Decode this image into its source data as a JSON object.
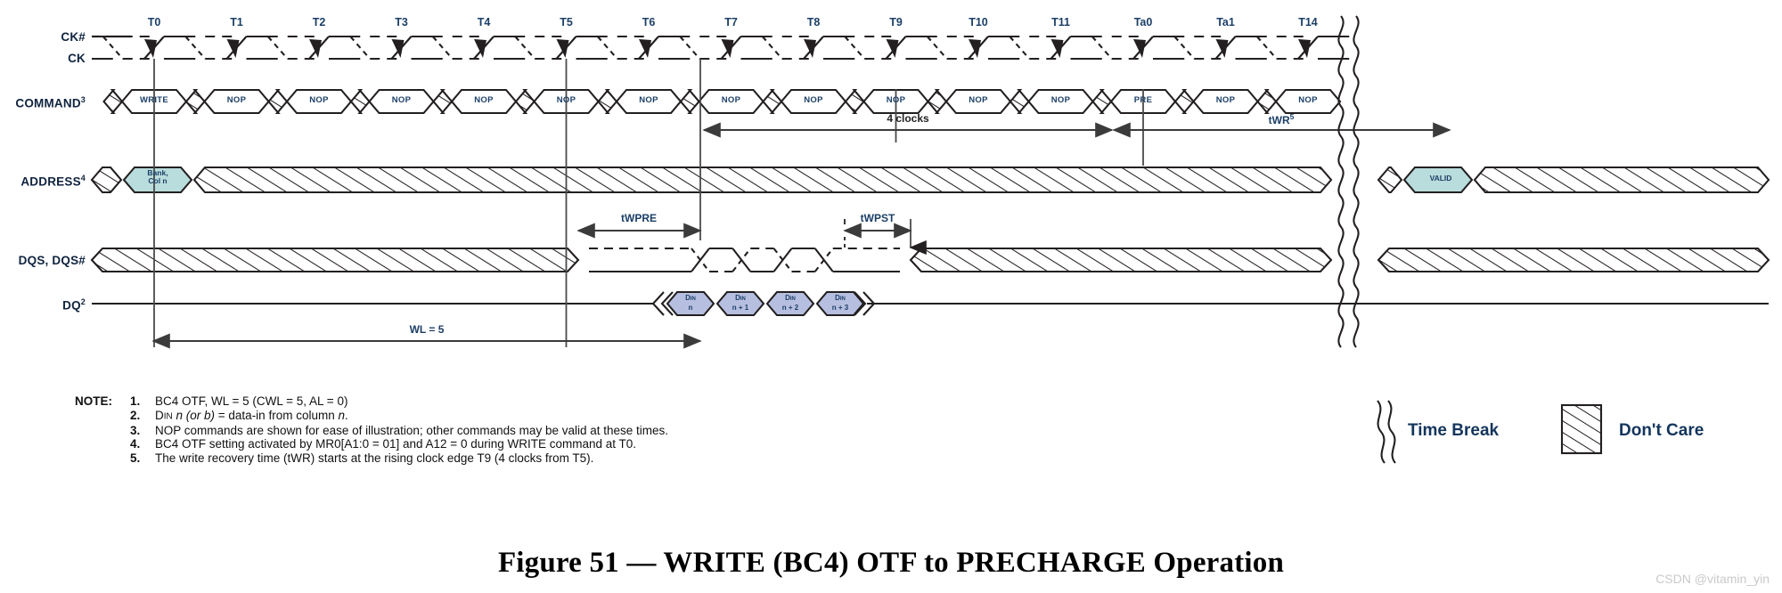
{
  "figure": {
    "title": "Figure 51 — WRITE (BC4) OTF to PRECHARGE Operation",
    "watermark": "CSDN @vitamin_yin"
  },
  "signals": [
    {
      "name": "ck-hash-label",
      "label": "CK#"
    },
    {
      "name": "ck-label",
      "label": "CK"
    },
    {
      "name": "command-label",
      "label": "COMMAND",
      "sup": "3"
    },
    {
      "name": "address-label",
      "label": "ADDRESS",
      "sup": "4"
    },
    {
      "name": "dqs-label",
      "label": "DQS, DQS#"
    },
    {
      "name": "dq-label",
      "label": "DQ",
      "sup": "2"
    }
  ],
  "clock_ticks": [
    "T0",
    "T1",
    "T2",
    "T3",
    "T4",
    "T5",
    "T6",
    "T7",
    "T8",
    "T9",
    "T10",
    "T11",
    "Ta0",
    "Ta1",
    "T14"
  ],
  "command_row": {
    "cells": [
      "WRITE",
      "NOP",
      "NOP",
      "NOP",
      "NOP",
      "NOP",
      "NOP",
      "NOP",
      "NOP",
      "NOP",
      "NOP",
      "NOP",
      "PRE",
      "NOP",
      "NOP"
    ]
  },
  "address_row": {
    "first_label_line1": "Bank,",
    "first_label_line2": "Col n",
    "second_label": "VALID",
    "fill_color": "#b9dcdc"
  },
  "dq_row": {
    "fill_color": "#b7bfe0",
    "beats": [
      {
        "top": "D",
        "sub": "IN",
        "bottom": "n"
      },
      {
        "top": "D",
        "sub": "IN",
        "bottom": "n + 1"
      },
      {
        "top": "D",
        "sub": "IN",
        "bottom": "n + 2"
      },
      {
        "top": "D",
        "sub": "IN",
        "bottom": "n + 3"
      }
    ]
  },
  "annotations": {
    "four_clocks": "4 clocks",
    "twr": "tWR",
    "twr_sup": "5",
    "twpre": "tWPRE",
    "twpst": "tWPST",
    "wl": "WL = 5"
  },
  "notes": {
    "heading": "NOTE:",
    "items": [
      {
        "num": "1.",
        "text": "BC4 OTF, WL = 5 (CWL = 5, AL = 0)"
      },
      {
        "num": "2.",
        "text": "DIN n (or b)  = data-in from column n."
      },
      {
        "num": "3.",
        "text": "NOP commands are shown for ease of illustration; other commands may be valid at these times."
      },
      {
        "num": "4.",
        "text": "BC4 OTF setting activated by MR0[A1:0 = 01] and A12 = 0 during WRITE command at T0."
      },
      {
        "num": "5.",
        "text": "The write recovery time (tWR) starts at the rising clock edge T9 (4 clocks from T5)."
      }
    ]
  },
  "legend": [
    {
      "name": "time-break",
      "label": "Time Break"
    },
    {
      "name": "dont-care",
      "label": "Don't Care"
    }
  ],
  "colors": {
    "label_blue": "#10243f",
    "tick_blue": "#1b3f66",
    "line_dark": "#231f20",
    "address_fill": "#b9dcdc",
    "dq_fill": "#b7bfe0",
    "watermark_gray": "#c9c9c9"
  }
}
